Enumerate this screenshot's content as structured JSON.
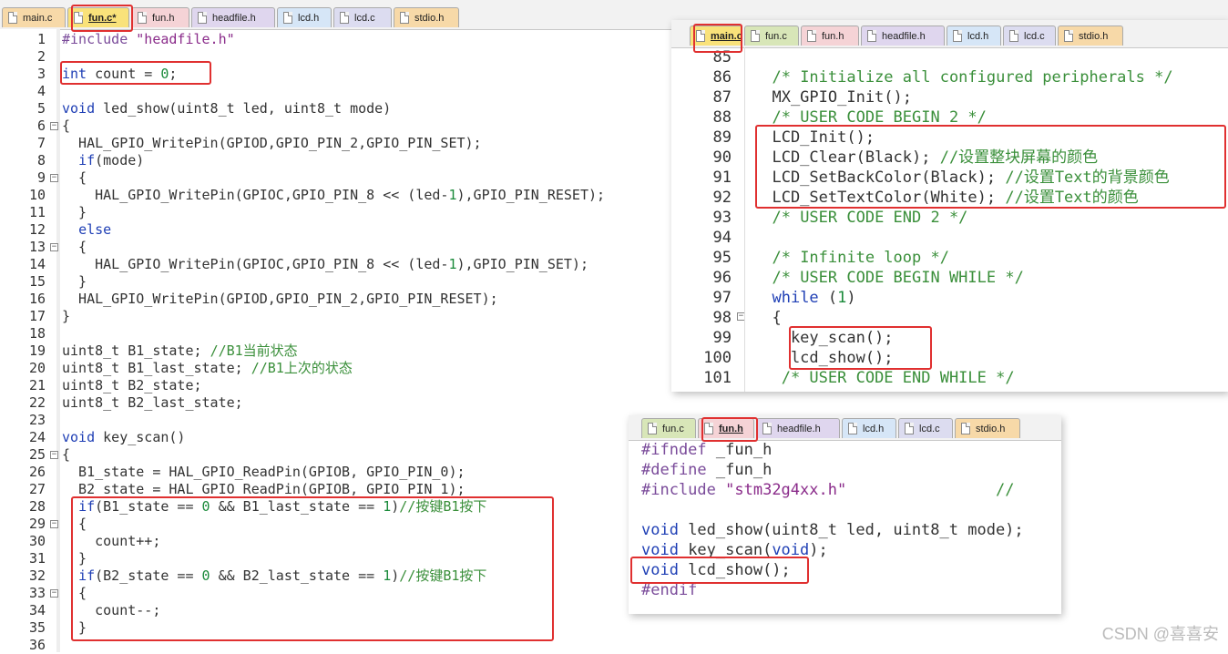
{
  "left_tabs": [
    {
      "label": "main.c",
      "color": "c-orange"
    },
    {
      "label": "fun.c*",
      "color": "c-yellow",
      "active": true
    },
    {
      "label": "fun.h",
      "color": "c-pink"
    },
    {
      "label": "headfile.h",
      "color": "c-purple"
    },
    {
      "label": "lcd.h",
      "color": "c-blue"
    },
    {
      "label": "lcd.c",
      "color": "c-lav"
    },
    {
      "label": "stdio.h",
      "color": "c-orange"
    }
  ],
  "left_lines": [
    {
      "n": "1",
      "html": "<span class='pp'>#include</span> <span class='str'>\"headfile.h\"</span>"
    },
    {
      "n": "2",
      "html": ""
    },
    {
      "n": "3",
      "html": "<span class='kw'>int</span> count = <span class='n'>0</span>;"
    },
    {
      "n": "4",
      "html": ""
    },
    {
      "n": "5",
      "html": "<span class='kw'>void</span> led_show(uint8_t led, uint8_t mode)"
    },
    {
      "n": "6",
      "html": "{",
      "fold": "−"
    },
    {
      "n": "7",
      "html": "  HAL_GPIO_WritePin(GPIOD,GPIO_PIN_2,GPIO_PIN_SET);"
    },
    {
      "n": "8",
      "html": "  <span class='kw'>if</span>(mode)"
    },
    {
      "n": "9",
      "html": "  {",
      "fold": "−"
    },
    {
      "n": "10",
      "html": "    HAL_GPIO_WritePin(GPIOC,GPIO_PIN_8 &lt;&lt; (led-<span class='n'>1</span>),GPIO_PIN_RESET);"
    },
    {
      "n": "11",
      "html": "  }"
    },
    {
      "n": "12",
      "html": "  <span class='kw'>else</span>"
    },
    {
      "n": "13",
      "html": "  {",
      "fold": "−"
    },
    {
      "n": "14",
      "html": "    HAL_GPIO_WritePin(GPIOC,GPIO_PIN_8 &lt;&lt; (led-<span class='n'>1</span>),GPIO_PIN_SET);"
    },
    {
      "n": "15",
      "html": "  }"
    },
    {
      "n": "16",
      "html": "  HAL_GPIO_WritePin(GPIOD,GPIO_PIN_2,GPIO_PIN_RESET);"
    },
    {
      "n": "17",
      "html": "}"
    },
    {
      "n": "18",
      "html": ""
    },
    {
      "n": "19",
      "html": "uint8_t B1_state; <span class='cm'>//B1当前状态</span>"
    },
    {
      "n": "20",
      "html": "uint8_t B1_last_state; <span class='cm'>//B1上次的状态</span>"
    },
    {
      "n": "21",
      "html": "uint8_t B2_state;"
    },
    {
      "n": "22",
      "html": "uint8_t B2_last_state;"
    },
    {
      "n": "23",
      "html": ""
    },
    {
      "n": "24",
      "html": "<span class='kw'>void</span> key_scan()"
    },
    {
      "n": "25",
      "html": "{",
      "fold": "−"
    },
    {
      "n": "26",
      "html": "  B1_state = HAL_GPIO_ReadPin(GPIOB, GPIO_PIN_0);"
    },
    {
      "n": "27",
      "html": "  B2_state = HAL_GPIO_ReadPin(GPIOB, GPIO_PIN_1);"
    },
    {
      "n": "28",
      "html": "  <span class='kw'>if</span>(B1_state == <span class='n'>0</span> &amp;&amp; B1_last_state == <span class='n'>1</span>)<span class='cm'>//按键B1按下</span>"
    },
    {
      "n": "29",
      "html": "  {",
      "fold": "−"
    },
    {
      "n": "30",
      "html": "    count++;"
    },
    {
      "n": "31",
      "html": "  }"
    },
    {
      "n": "32",
      "html": "  <span class='kw'>if</span>(B2_state == <span class='n'>0</span> &amp;&amp; B2_last_state == <span class='n'>1</span>)<span class='cm'>//按键B1按下</span>"
    },
    {
      "n": "33",
      "html": "  {",
      "fold": "−"
    },
    {
      "n": "34",
      "html": "    count--;"
    },
    {
      "n": "35",
      "html": "  }"
    },
    {
      "n": "36",
      "html": ""
    }
  ],
  "main_tabs": [
    {
      "label": "main.c",
      "color": "c-yellow",
      "active": true
    },
    {
      "label": "fun.c",
      "color": "c-green"
    },
    {
      "label": "fun.h",
      "color": "c-pink"
    },
    {
      "label": "headfile.h",
      "color": "c-purple"
    },
    {
      "label": "lcd.h",
      "color": "c-blue"
    },
    {
      "label": "lcd.c",
      "color": "c-lav"
    },
    {
      "label": "stdio.h",
      "color": "c-orange"
    }
  ],
  "main_lines": [
    {
      "n": "85",
      "html": ""
    },
    {
      "n": "86",
      "html": "  <span class='cm'>/* Initialize all configured peripherals */</span>"
    },
    {
      "n": "87",
      "html": "  MX_GPIO_Init();"
    },
    {
      "n": "88",
      "html": "  <span class='cm'>/* USER CODE BEGIN 2 */</span>"
    },
    {
      "n": "89",
      "html": "  LCD_Init();"
    },
    {
      "n": "90",
      "html": "  LCD_Clear(Black); <span class='cm'>//设置整块屏幕的颜色</span>"
    },
    {
      "n": "91",
      "html": "  LCD_SetBackColor(Black); <span class='cm'>//设置Text的背景颜色</span>"
    },
    {
      "n": "92",
      "html": "  LCD_SetTextColor(White); <span class='cm'>//设置Text的颜色</span>"
    },
    {
      "n": "93",
      "html": "  <span class='cm'>/* USER CODE END 2 */</span>"
    },
    {
      "n": "94",
      "html": ""
    },
    {
      "n": "95",
      "html": "  <span class='cm'>/* Infinite loop */</span>"
    },
    {
      "n": "96",
      "html": "  <span class='cm'>/* USER CODE BEGIN WHILE */</span>"
    },
    {
      "n": "97",
      "html": "  <span class='kw'>while</span> (<span class='n'>1</span>)"
    },
    {
      "n": "98",
      "html": "  {",
      "fold": "−"
    },
    {
      "n": "99",
      "html": "    key_scan();"
    },
    {
      "n": "100",
      "html": "    lcd_show();"
    },
    {
      "n": "101",
      "html": "   <span class='cm'>/* USER CODE END WHILE */</span>"
    }
  ],
  "funh_tabs": [
    {
      "label": "fun.c",
      "color": "c-green"
    },
    {
      "label": "fun.h",
      "color": "c-pink",
      "active": true
    },
    {
      "label": "headfile.h",
      "color": "c-purple"
    },
    {
      "label": "lcd.h",
      "color": "c-blue"
    },
    {
      "label": "lcd.c",
      "color": "c-lav"
    },
    {
      "label": "stdio.h",
      "color": "c-orange"
    }
  ],
  "funh_lines": [
    {
      "html": "<span class='pp'>#ifndef</span> _fun_h"
    },
    {
      "html": "<span class='pp'>#define</span> _fun_h"
    },
    {
      "html": "<span class='pp'>#include</span> <span class='str'>\"stm32g4xx.h\"</span>                <span class='cm'>//</span>"
    },
    {
      "html": ""
    },
    {
      "html": "<span class='kw'>void</span> led_show(uint8_t led, uint8_t mode);"
    },
    {
      "html": "<span class='kw'>void</span> key_scan(<span class='kw'>void</span>);"
    },
    {
      "html": "<span class='kw'>void</span> lcd_show();"
    },
    {
      "html": "<span class='pp'>#endif</span>"
    }
  ],
  "watermark": "CSDN @喜喜安"
}
